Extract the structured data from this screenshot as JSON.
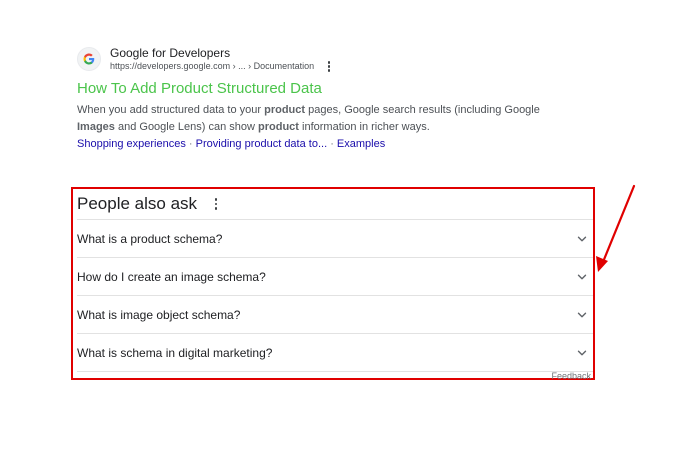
{
  "result": {
    "site_name": "Google for Developers",
    "url": "https://developers.google.com › ... › Documentation",
    "favicon_icon": "google-g-icon",
    "title": "How To Add Product Structured Data",
    "snippet": {
      "p1": "When you add structured data to your ",
      "b1": "product",
      "p2": " pages, Google search results (including Google ",
      "b2": "Images",
      "p3": " and Google Lens) can show ",
      "b3": "product",
      "p4": " information in richer ways."
    },
    "sitelinks": [
      "Shopping experiences",
      "Providing product data to...",
      "Examples"
    ],
    "sitelink_separator": "·"
  },
  "people_also_ask": {
    "title": "People also ask",
    "questions": [
      "What is a product schema?",
      "How do I create an image schema?",
      "What is image object schema?",
      "What is schema in digital marketing?"
    ],
    "feedback": "Feedback"
  },
  "colors": {
    "title_link": "#4bc44b",
    "sitelink": "#1a0dab",
    "annotation": "#e00000"
  }
}
